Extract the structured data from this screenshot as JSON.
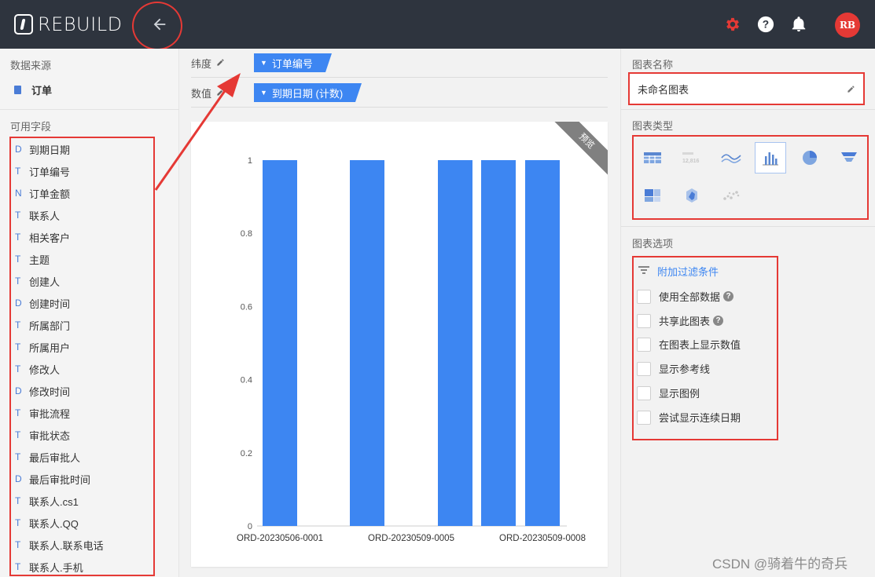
{
  "header": {
    "logo_text": "REBUILD",
    "avatar": "RB",
    "icons": [
      "back-arrow-icon",
      "gear-icon",
      "help-icon",
      "bell-icon"
    ],
    "accent_color": "#e53935"
  },
  "left": {
    "source_title": "数据来源",
    "source_name": "订单",
    "fields_title": "可用字段",
    "fields": [
      {
        "type": "D",
        "label": "到期日期"
      },
      {
        "type": "T",
        "label": "订单编号"
      },
      {
        "type": "N",
        "label": "订单金额"
      },
      {
        "type": "T",
        "label": "联系人"
      },
      {
        "type": "T",
        "label": "相关客户"
      },
      {
        "type": "T",
        "label": "主题"
      },
      {
        "type": "T",
        "label": "创建人"
      },
      {
        "type": "D",
        "label": "创建时间"
      },
      {
        "type": "T",
        "label": "所属部门"
      },
      {
        "type": "T",
        "label": "所属用户"
      },
      {
        "type": "T",
        "label": "修改人"
      },
      {
        "type": "D",
        "label": "修改时间"
      },
      {
        "type": "T",
        "label": "审批流程"
      },
      {
        "type": "T",
        "label": "审批状态"
      },
      {
        "type": "T",
        "label": "最后审批人"
      },
      {
        "type": "D",
        "label": "最后审批时间"
      },
      {
        "type": "T",
        "label": "联系人.cs1"
      },
      {
        "type": "T",
        "label": "联系人.QQ"
      },
      {
        "type": "T",
        "label": "联系人.联系电话"
      },
      {
        "type": "T",
        "label": "联系人.手机"
      }
    ]
  },
  "center": {
    "dimension_label": "纬度",
    "dimension_value": "订单编号",
    "measure_label": "数值",
    "measure_value": "到期日期 (计数)",
    "preview_badge": "预览"
  },
  "chart_data": {
    "type": "bar",
    "categories": [
      "ORD-20230506-0001",
      "",
      "ORD-20230509-0005",
      "",
      "ORD-20230509-0008"
    ],
    "values": [
      1,
      1,
      1,
      1,
      1
    ],
    "x_tick_labels": [
      "ORD-20230506-0001",
      "ORD-20230509-0005",
      "ORD-20230509-0008"
    ],
    "y_ticks": [
      "0",
      "0.2",
      "0.4",
      "0.6",
      "0.8",
      "1"
    ],
    "ylim": [
      0,
      1
    ],
    "bar_color": "#3d86f2",
    "title": "",
    "xlabel": "",
    "ylabel": ""
  },
  "right": {
    "name_title": "图表名称",
    "name_value": "未命名图表",
    "type_title": "图表类型",
    "types": [
      "table-chart-icon",
      "index-chart-icon",
      "line-chart-icon",
      "bar-chart-icon",
      "pie-chart-icon",
      "funnel-chart-icon",
      "treemap-chart-icon",
      "radar-chart-icon",
      "scatter-chart-icon"
    ],
    "selected_type": "bar-chart-icon",
    "options_title": "图表选项",
    "filter_label": "附加过滤条件",
    "options": [
      "使用全部数据",
      "共享此图表",
      "在图表上显示数值",
      "显示参考线",
      "显示图例",
      "尝试显示连续日期"
    ]
  },
  "watermark": "CSDN @骑着牛的奇兵"
}
